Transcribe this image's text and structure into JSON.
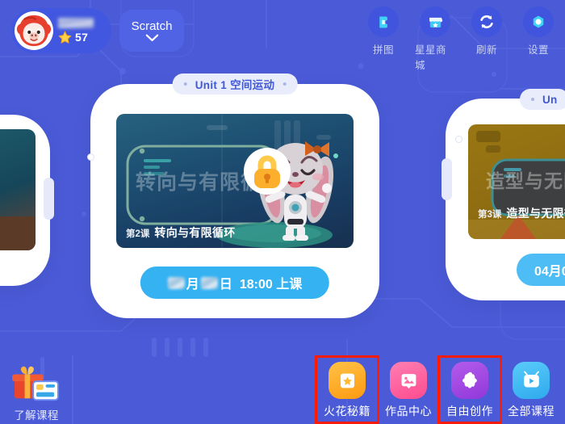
{
  "app": {
    "background_color": "#4B5BD7",
    "accent_color": "#35B2F2",
    "highlight_color": "#FF1A00"
  },
  "topbar": {
    "user": {
      "avatar_icon": "monkey-avatar-icon",
      "username_masked": "",
      "star_icon": "star-icon",
      "star_count": "57"
    },
    "course_selector": {
      "label": "Scratch",
      "chevron_icon": "chevron-down-icon"
    },
    "nav_items": [
      {
        "label": "拼图",
        "icon": "puzzle-icon"
      },
      {
        "label": "星星商城",
        "icon": "store-icon"
      },
      {
        "label": "刷新",
        "icon": "refresh-icon"
      },
      {
        "label": "设置",
        "icon": "gear-icon"
      }
    ]
  },
  "carousel": {
    "cards": [
      {
        "id": "card-left-partial",
        "unit_badge": "",
        "ghost_title": "",
        "lesson_number": "",
        "lesson_title": "",
        "schedule_label": "",
        "locked": false
      },
      {
        "id": "card-center",
        "unit_badge": "Unit 1 空间运动",
        "ghost_title": "转向与有限循环",
        "lesson_number": "第2课",
        "lesson_title": "转向与有限循环",
        "schedule_prefix_masked": "",
        "schedule_month_unit": "月",
        "schedule_day_unit": "日",
        "schedule_time": "18:00 上课",
        "locked": true,
        "lock_icon": "lock-icon",
        "character_icon": "rabbit-astronaut-icon"
      },
      {
        "id": "card-right-partial",
        "unit_badge": "Un",
        "ghost_title": "造型与无限",
        "lesson_number": "第3课",
        "lesson_title": "造型与无限循",
        "schedule_label": "04月0",
        "locked": false
      }
    ]
  },
  "bottombar": {
    "learn_more": {
      "label": "了解课程",
      "icon": "gift-box-icon"
    },
    "quick_actions": [
      {
        "label": "火花秘籍",
        "icon": "star-card-icon",
        "color": "#FFA318",
        "highlighted": true
      },
      {
        "label": "作品中心",
        "icon": "gallery-icon",
        "color": "#FF5E9C",
        "highlighted": false
      },
      {
        "label": "自由创作",
        "icon": "puzzle-piece-icon",
        "color": "#A24BE0",
        "highlighted": true
      },
      {
        "label": "全部课程",
        "icon": "video-play-icon",
        "color": "#3FB9F5",
        "highlighted": false
      }
    ]
  }
}
